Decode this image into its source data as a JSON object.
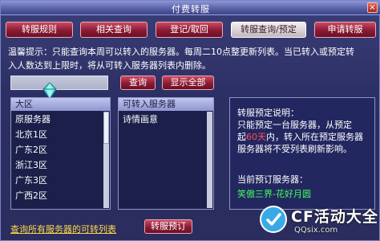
{
  "window": {
    "title": "付费转服",
    "close_glyph": "×"
  },
  "tabs": [
    {
      "label": "转服规则",
      "active": false
    },
    {
      "label": "相关查询",
      "active": false
    },
    {
      "label": "登记/取回",
      "active": false
    },
    {
      "label": "转服查询/预定",
      "active": true
    },
    {
      "label": "申请转服",
      "active": false
    }
  ],
  "notice": {
    "line1": "温馨提示：只能查询本周可以转入的服务器。每周二10点整更新列表。当已转入或预定转",
    "line2": "入人数达到上限时，将从可转入服务器列表内删除。"
  },
  "search": {
    "value": "",
    "query_button": "查询",
    "show_all_button": "显示全部",
    "icon": "crystal-icon"
  },
  "region_list": {
    "header": "大区",
    "items": [
      "原服务器",
      "北京1区",
      "广东2区",
      "浙江3区",
      "广东3区",
      "广西2区"
    ]
  },
  "server_list": {
    "header": "可转入服务器",
    "items": [
      "诗情画意"
    ]
  },
  "info": {
    "title": "转服预定说明：",
    "line1": "只能预定一台服务器，从预定",
    "line2_pre": "起",
    "line2_hl": "60天",
    "line2_post": "内，转入所在预定服务器",
    "line3": "服务器将不受列表刷新影响。",
    "current_label": "当前预订服务器：",
    "current_value": "笑傲三界-花好月圆"
  },
  "bottom": {
    "link": "查询所有服务器的可转列表",
    "reserve_button": "转服预订"
  },
  "watermark": {
    "title": "CF活动大全",
    "sub": "QQsix.com"
  }
}
